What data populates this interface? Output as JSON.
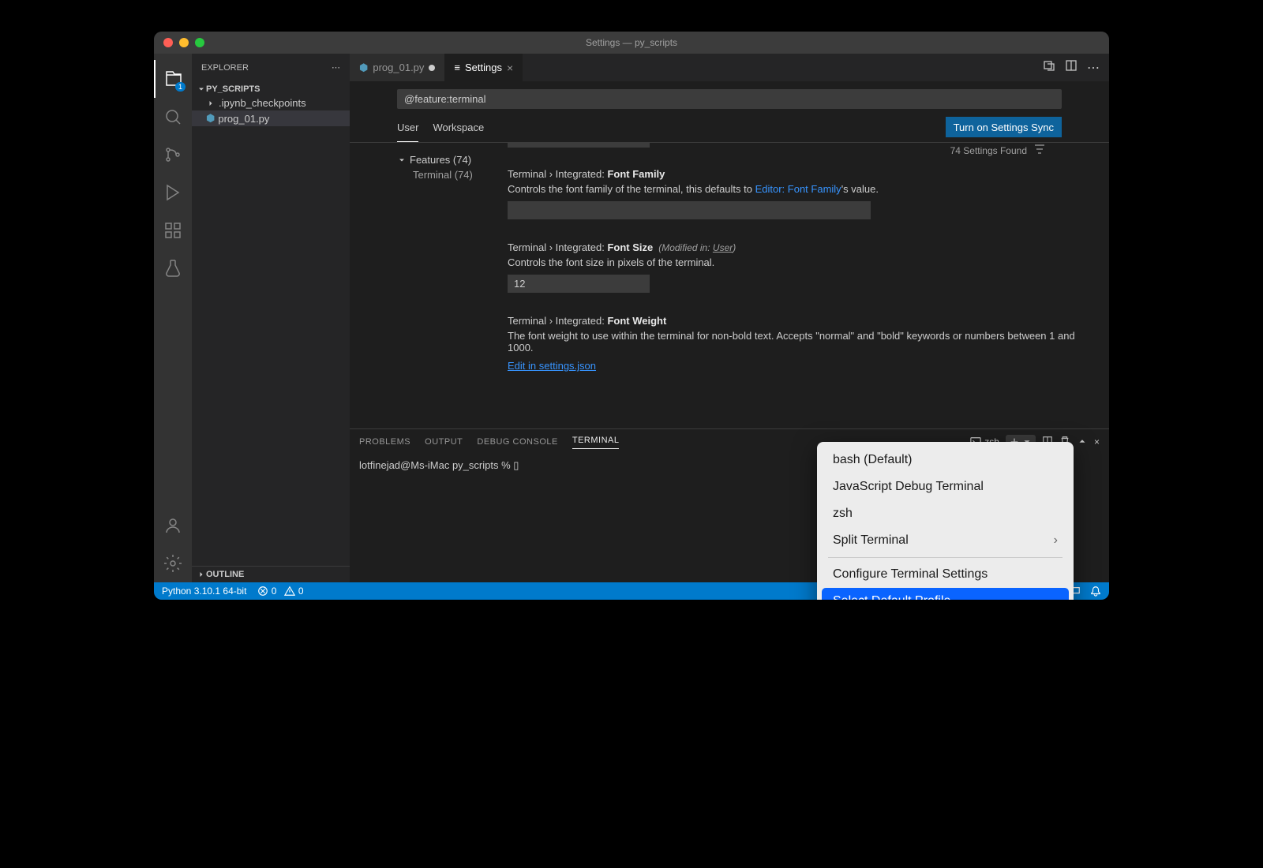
{
  "window_title": "Settings — py_scripts",
  "sidebar": {
    "header": "EXPLORER",
    "project": "PY_SCRIPTS",
    "items": [
      {
        "name": ".ipynb_checkpoints",
        "type": "folder"
      },
      {
        "name": "prog_01.py",
        "type": "file",
        "active": true
      }
    ],
    "outline": "OUTLINE"
  },
  "tabs": [
    {
      "label": "prog_01.py",
      "modified": true
    },
    {
      "label": "Settings",
      "active": true
    }
  ],
  "search": {
    "value": "@feature:terminal",
    "count_text": "74 Settings Found"
  },
  "scopes": {
    "user": "User",
    "workspace": "Workspace"
  },
  "sync_button": "Turn on Settings Sync",
  "toc": {
    "features": "Features (74)",
    "terminal": "Terminal (74)"
  },
  "settings": [
    {
      "path": "Terminal › Integrated: ",
      "name": "Font Family",
      "desc_pre": "Controls the font family of the terminal, this defaults to ",
      "desc_link": "Editor: Font Family",
      "desc_post": "'s value.",
      "value": ""
    },
    {
      "path": "Terminal › Integrated: ",
      "name": "Font Size",
      "modified_prefix": "(Modified in: ",
      "modified_scope": "User",
      "modified_suffix": ")",
      "desc": "Controls the font size in pixels of the terminal.",
      "value": "12"
    },
    {
      "path": "Terminal › Integrated: ",
      "name": "Font Weight",
      "desc": "The font weight to use within the terminal for non-bold text. Accepts \"normal\" and \"bold\" keywords or numbers between 1 and 1000.",
      "edit_link": "Edit in settings.json"
    }
  ],
  "panel": {
    "tabs": {
      "problems": "PROBLEMS",
      "output": "OUTPUT",
      "debug": "DEBUG CONSOLE",
      "terminal": "TERMINAL"
    },
    "shell": "zsh",
    "prompt": "lotfinejad@Ms-iMac py_scripts % ▯"
  },
  "statusbar": {
    "python": "Python 3.10.1 64-bit",
    "errors": "0",
    "warnings": "0"
  },
  "context_menu": [
    {
      "label": "bash (Default)"
    },
    {
      "label": "JavaScript Debug Terminal"
    },
    {
      "label": "zsh"
    },
    {
      "label": "Split Terminal",
      "submenu": true
    },
    {
      "separator": true
    },
    {
      "label": "Configure Terminal Settings"
    },
    {
      "label": "Select Default Profile",
      "highlighted": true
    }
  ],
  "activity_badge": "1"
}
